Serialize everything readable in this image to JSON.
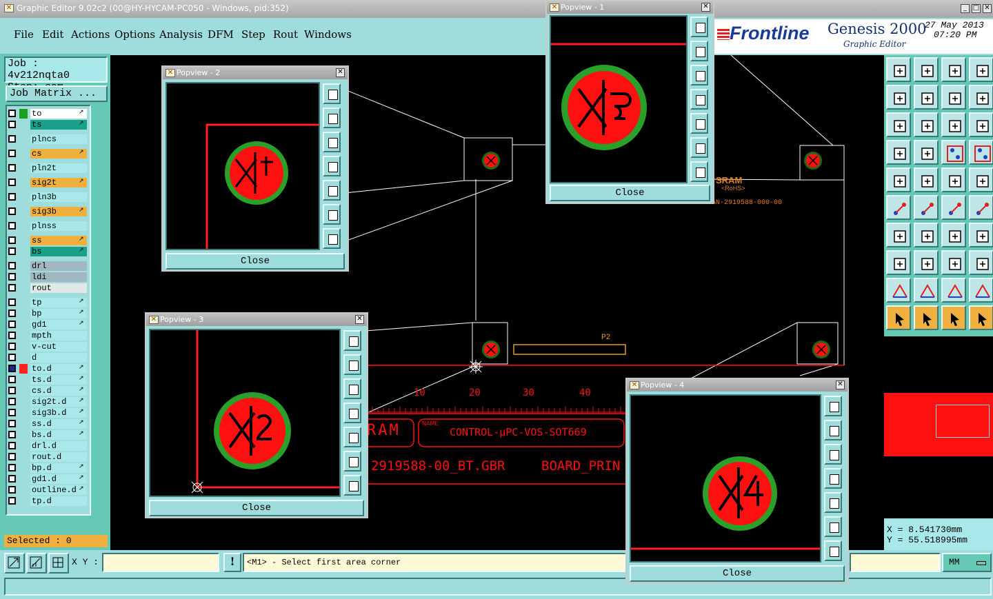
{
  "window": {
    "title": "Graphic Editor 9.02c2 (00@HY-HYCAM-PC050 - Windows, pid:352)"
  },
  "menu": [
    "File",
    "Edit",
    "Actions",
    "Options",
    "Analysis",
    "DFM",
    "Step",
    "Rout",
    "Windows"
  ],
  "brand": {
    "logo": "Frontline",
    "product": "Genesis 2000",
    "subtitle": "Graphic Editor",
    "date": "27 May 2013",
    "time": "07:20 PM"
  },
  "job": {
    "job_label": "Job : 4v212nqta0",
    "step_label": "Step: cam",
    "matrix_button": "Job Matrix ...",
    "selected": "Selected : 0"
  },
  "layers": [
    {
      "name": "to",
      "color": "#ffffff",
      "swatch": "#1aa01a"
    },
    {
      "name": "ts",
      "color": "#1aa088",
      "swatch": ""
    },
    {
      "name": "plncs",
      "color": "#a8e8e8",
      "swatch": ""
    },
    {
      "name": "cs",
      "color": "#f0b040",
      "swatch": ""
    },
    {
      "name": "pln2t",
      "color": "#a8e8e8",
      "swatch": ""
    },
    {
      "name": "sig2t",
      "color": "#f0b040",
      "swatch": ""
    },
    {
      "name": "pln3b",
      "color": "#a8e8e8",
      "swatch": ""
    },
    {
      "name": "sig3b",
      "color": "#f0b040",
      "swatch": ""
    },
    {
      "name": "plnss",
      "color": "#a8e8e8",
      "swatch": ""
    },
    {
      "name": "ss",
      "color": "#f0b040",
      "swatch": ""
    },
    {
      "name": "bs",
      "color": "#1aa088",
      "swatch": ""
    },
    {
      "name": "drl",
      "color": "#a0b8c0",
      "swatch": ""
    },
    {
      "name": "ldi",
      "color": "#a0b8c0",
      "swatch": ""
    },
    {
      "name": "rout",
      "color": "#e0e8e8",
      "swatch": ""
    },
    {
      "name": "tp",
      "color": "#a8e8e8",
      "swatch": ""
    },
    {
      "name": "bp",
      "color": "#a8e8e8",
      "swatch": ""
    },
    {
      "name": "gd1",
      "color": "#a8e8e8",
      "swatch": ""
    },
    {
      "name": "mpth",
      "color": "#a8e8e8",
      "swatch": ""
    },
    {
      "name": "v-cut",
      "color": "#a8e8e8",
      "swatch": ""
    },
    {
      "name": "d",
      "color": "#a8e8e8",
      "swatch": ""
    },
    {
      "name": "to.d",
      "color": "#a8e8e8",
      "swatch": "#ff2020"
    },
    {
      "name": "ts.d",
      "color": "#a8e8e8",
      "swatch": ""
    },
    {
      "name": "cs.d",
      "color": "#a8e8e8",
      "swatch": ""
    },
    {
      "name": "sig2t.d",
      "color": "#a8e8e8",
      "swatch": ""
    },
    {
      "name": "sig3b.d",
      "color": "#a8e8e8",
      "swatch": ""
    },
    {
      "name": "ss.d",
      "color": "#a8e8e8",
      "swatch": ""
    },
    {
      "name": "bs.d",
      "color": "#a8e8e8",
      "swatch": ""
    },
    {
      "name": "drl.d",
      "color": "#a8e8e8",
      "swatch": ""
    },
    {
      "name": "rout.d",
      "color": "#a8e8e8",
      "swatch": ""
    },
    {
      "name": "bp.d",
      "color": "#a8e8e8",
      "swatch": ""
    },
    {
      "name": "gd1.d",
      "color": "#a8e8e8",
      "swatch": ""
    },
    {
      "name": "outline.d",
      "color": "#a8e8e8",
      "swatch": ""
    },
    {
      "name": "tp.d",
      "color": "#a8e8e8",
      "swatch": ""
    }
  ],
  "popups": {
    "p1": {
      "title": "Popview - 1",
      "close": "Close"
    },
    "p2": {
      "title": "Popview - 2",
      "close": "Close"
    },
    "p3": {
      "title": "Popview - 3",
      "close": "Close"
    },
    "p4": {
      "title": "Popview - 4",
      "close": "Close"
    }
  },
  "board_text": {
    "sram": "SRAM",
    "rohs": "<RoHS>",
    "pn": "IAN-2919588-000-00",
    "ruler": [
      "10",
      "20",
      "30",
      "40"
    ],
    "ram": "RAM",
    "name_tag": "NAME:",
    "control": "CONTROL-μPC-VOS-SOT669",
    "gbr": "2919588-00_BT.GBR",
    "board_prin": "BOARD_PRIN",
    "p2": "P2"
  },
  "status": {
    "xy_label": "X Y :",
    "xy_value": "",
    "prompt": "<M1> - Select first area corner",
    "units": "MM",
    "x_coord": "X = 8.541730mm",
    "y_coord": "Y = 55.518995mm"
  }
}
